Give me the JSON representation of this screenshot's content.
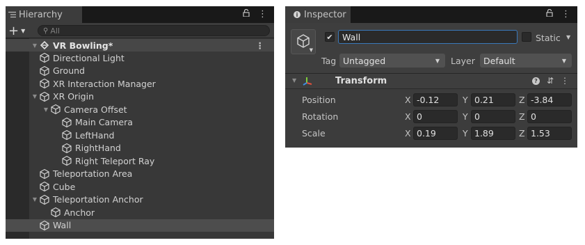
{
  "hierarchy": {
    "tab_title": "Hierarchy",
    "tab_icon": "list-icon",
    "lock_icon": "lock-icon",
    "add_button": "+",
    "search_placeholder": "All",
    "scene_name": "VR Bowling*",
    "rows": [
      {
        "label": "Directional Light",
        "indent": 1,
        "arrow": ""
      },
      {
        "label": "Ground",
        "indent": 1,
        "arrow": ""
      },
      {
        "label": "XR Interaction Manager",
        "indent": 1,
        "arrow": ""
      },
      {
        "label": "XR Origin",
        "indent": 1,
        "arrow": "▼"
      },
      {
        "label": "Camera Offset",
        "indent": 2,
        "arrow": "▼"
      },
      {
        "label": "Main Camera",
        "indent": 3,
        "arrow": ""
      },
      {
        "label": "LeftHand",
        "indent": 3,
        "arrow": ""
      },
      {
        "label": "RightHand",
        "indent": 3,
        "arrow": ""
      },
      {
        "label": "Right Teleport Ray",
        "indent": 3,
        "arrow": ""
      },
      {
        "label": "Teleportation Area",
        "indent": 1,
        "arrow": ""
      },
      {
        "label": "Cube",
        "indent": 1,
        "arrow": ""
      },
      {
        "label": "Teleportation Anchor",
        "indent": 1,
        "arrow": "▼"
      },
      {
        "label": "Anchor",
        "indent": 2,
        "arrow": ""
      },
      {
        "label": "Wall",
        "indent": 1,
        "arrow": "",
        "selected": true
      }
    ]
  },
  "inspector": {
    "tab_title": "Inspector",
    "object_name": "Wall",
    "active": true,
    "static_label": "Static",
    "tag_label": "Tag",
    "tag_value": "Untagged",
    "layer_label": "Layer",
    "layer_value": "Default",
    "component_title": "Transform",
    "transform": [
      {
        "label": "Position",
        "x": "-0.12",
        "y": "0.21",
        "z": "-3.84"
      },
      {
        "label": "Rotation",
        "x": "0",
        "y": "0",
        "z": "0"
      },
      {
        "label": "Scale",
        "x": "0.19",
        "y": "1.89",
        "z": "1.53"
      }
    ],
    "axis_labels": [
      "X",
      "Y",
      "Z"
    ]
  },
  "colors": {
    "panel_bg": "#383838",
    "tab_bar": "#191919",
    "field_bg": "#2a2a2a",
    "focus_blue": "#3a79bb",
    "selected_row": "#4d4d4d"
  }
}
